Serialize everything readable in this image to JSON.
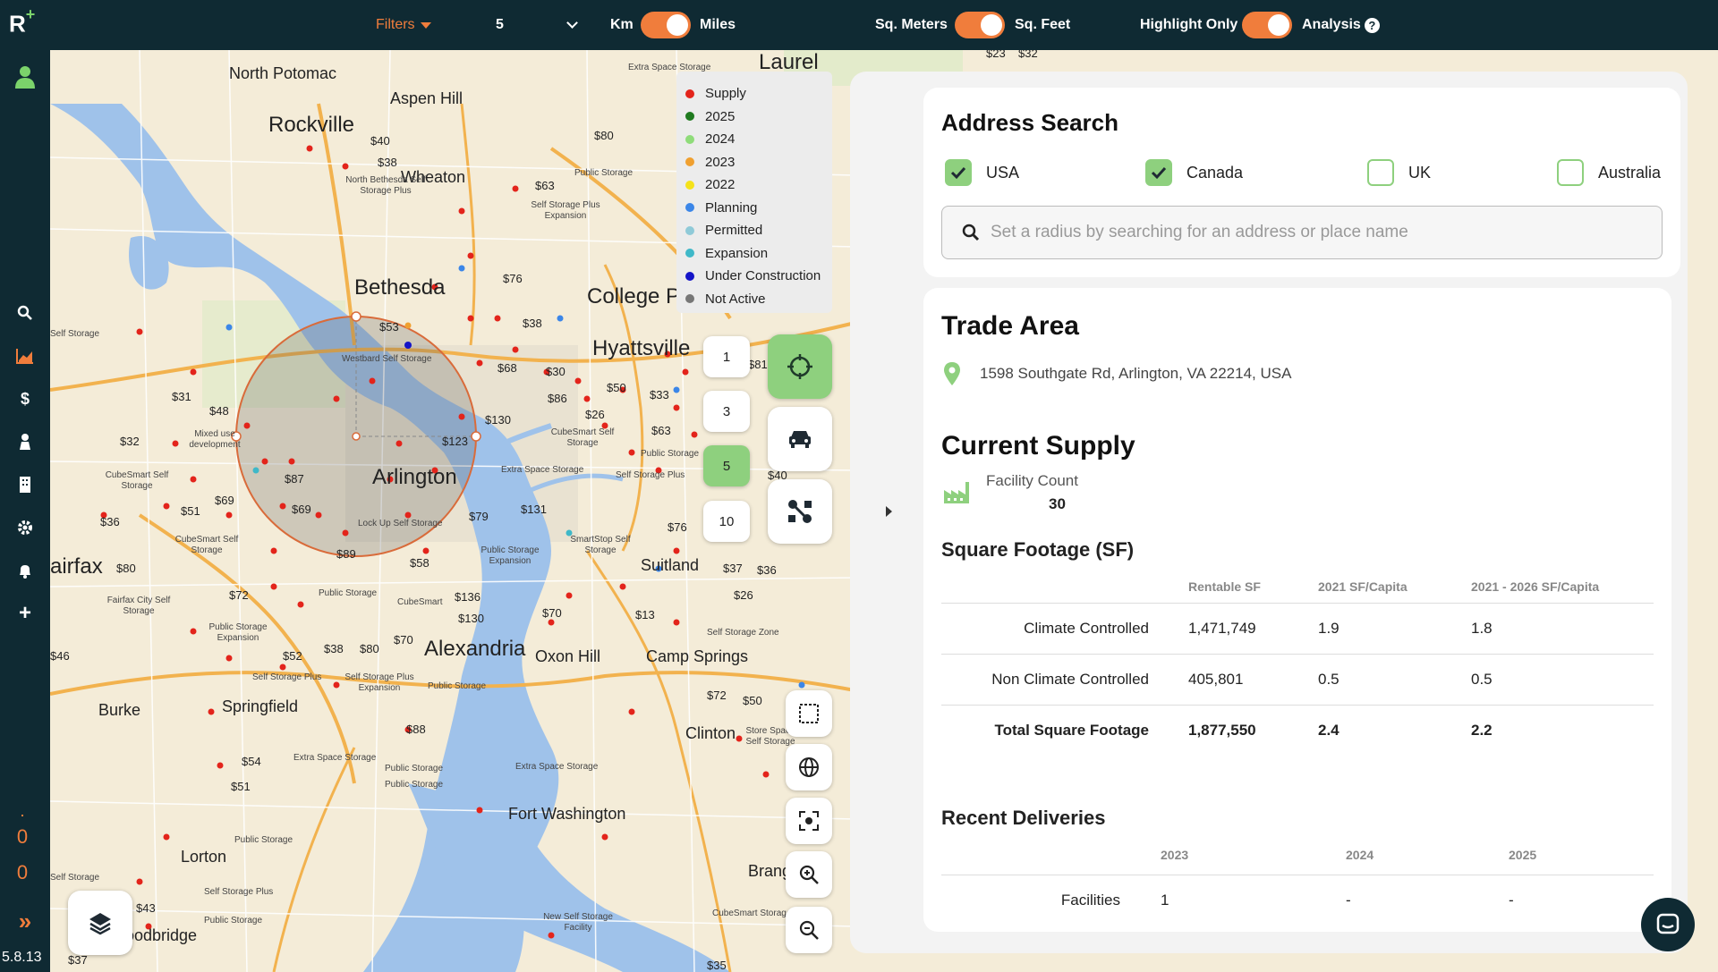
{
  "app": {
    "logo": "R",
    "logo_plus": "+",
    "version": "5.8.13"
  },
  "topbar": {
    "filters_label": "Filters",
    "radius_value": "5",
    "km_label": "Km",
    "miles_label": "Miles",
    "sqm_label": "Sq. Meters",
    "sqft_label": "Sq. Feet",
    "highlight_label": "Highlight Only",
    "analysis_label": "Analysis",
    "help_glyph": "?"
  },
  "sidebar": {
    "icons": [
      "user-icon",
      "search-icon",
      "chart-icon",
      "dollar-icon",
      "person-icon",
      "building-icon",
      "gear-icon",
      "bell-icon",
      "plus-icon"
    ],
    "counter_top": "0",
    "counter_bottom": "0",
    "expand_glyph": "»"
  },
  "legend": [
    {
      "label": "Supply",
      "color": "#e3241b"
    },
    {
      "label": "2025",
      "color": "#1f7a1f"
    },
    {
      "label": "2024",
      "color": "#8fdc7a"
    },
    {
      "label": "2023",
      "color": "#f0a030"
    },
    {
      "label": "2022",
      "color": "#f5e21a"
    },
    {
      "label": "Planning",
      "color": "#3b86e8"
    },
    {
      "label": "Permitted",
      "color": "#8fcad8"
    },
    {
      "label": "Expansion",
      "color": "#3fb8c8"
    },
    {
      "label": "Under Construction",
      "color": "#1414c8"
    },
    {
      "label": "Not Active",
      "color": "#777777"
    }
  ],
  "radius_options": [
    "1",
    "3",
    "5",
    "10"
  ],
  "radius_selected": "5",
  "map_labels": {
    "cities": [
      "Rockville",
      "Bethesda",
      "College P",
      "Hyattsville",
      "Arlington",
      "Alexandria",
      "Laurel"
    ],
    "towns": [
      "North Potomac",
      "Aspen Hill",
      "Wheaton",
      "Oxon Hill",
      "Suitland",
      "Camp Springs",
      "Springfield",
      "Burke",
      "Clinton",
      "Fort Washington",
      "Lorton",
      "Brang",
      "oodbridge",
      "airfax"
    ],
    "prices": [
      "$40",
      "$38",
      "$80",
      "$63",
      "$76",
      "$53",
      "$38",
      "$68",
      "$30",
      "$86",
      "$50",
      "$33",
      "$26",
      "$63",
      "$130",
      "$123",
      "$31",
      "$48",
      "$32",
      "$87",
      "$69",
      "$51",
      "$36",
      "$80",
      "$69",
      "$79",
      "$131",
      "$76",
      "$37",
      "$36",
      "$89",
      "$58",
      "$136",
      "$130",
      "$70",
      "$26",
      "$13",
      "$72",
      "$52",
      "$38",
      "$80",
      "$70",
      "$72",
      "$50",
      "$88",
      "$54",
      "$51",
      "$43",
      "$37",
      "$35",
      "$81",
      "$46",
      "$40",
      "$23",
      "$32"
    ],
    "facilities": [
      "Extra Space Storage",
      "North Bethesda Self Storage Plus",
      "Public Storage",
      "Self Storage Plus Expansion",
      "Westbard Self Storage",
      "Mixed use development",
      "CubeSmart Self Storage",
      "CubeSmart Self Storage",
      "Lock Up Self Storage",
      "Extra Space Storage",
      "CubeSmart Self Storage",
      "Public Storage",
      "Self Storage Plus",
      "Public Storage Expansion",
      "Public Storage",
      "CubeSmart",
      "SmartStop Self Storage",
      "Fairfax City Self Storage",
      "Public Storage Expansion",
      "Self Storage Plus",
      "Self Storage Plus Expansion",
      "Public Storage",
      "Self Storage Zone",
      "Store Space Self Storage",
      "Extra Space Storage",
      "Public Storage",
      "Public Storage",
      "Extra Space Storage",
      "Public Storage",
      "Self Storage Plus",
      "Public Storage",
      "New Self Storage Facility",
      "CubeSmart Storage",
      "Self Storage",
      "Self Storage"
    ]
  },
  "address_search": {
    "title": "Address Search",
    "countries": [
      {
        "label": "USA",
        "checked": true
      },
      {
        "label": "Canada",
        "checked": true
      },
      {
        "label": "UK",
        "checked": false
      },
      {
        "label": "Australia",
        "checked": false
      }
    ],
    "placeholder": "Set a radius by searching for an address or place name"
  },
  "trade_area": {
    "title": "Trade Area",
    "address": "1598 Southgate Rd, Arlington, VA 22214, USA",
    "current_supply_title": "Current Supply",
    "facility_count_label": "Facility Count",
    "facility_count": "30",
    "sf_title": "Square Footage (SF)",
    "sf_columns": [
      "Rentable SF",
      "2021 SF/Capita",
      "2021 - 2026 SF/Capita"
    ],
    "sf_rows": [
      {
        "label": "Climate Controlled",
        "rentable": "1,471,749",
        "sf2021": "1.9",
        "sf2026": "1.8"
      },
      {
        "label": "Non Climate Controlled",
        "rentable": "405,801",
        "sf2021": "0.5",
        "sf2026": "0.5"
      },
      {
        "label": "Total Square Footage",
        "rentable": "1,877,550",
        "sf2021": "2.4",
        "sf2026": "2.2"
      }
    ],
    "deliveries_title": "Recent Deliveries",
    "deliveries_columns": [
      "2023",
      "2024",
      "2025"
    ],
    "deliveries_rows": [
      {
        "label": "Facilities",
        "v2023": "1",
        "v2024": "-",
        "v2025": "-"
      }
    ]
  }
}
